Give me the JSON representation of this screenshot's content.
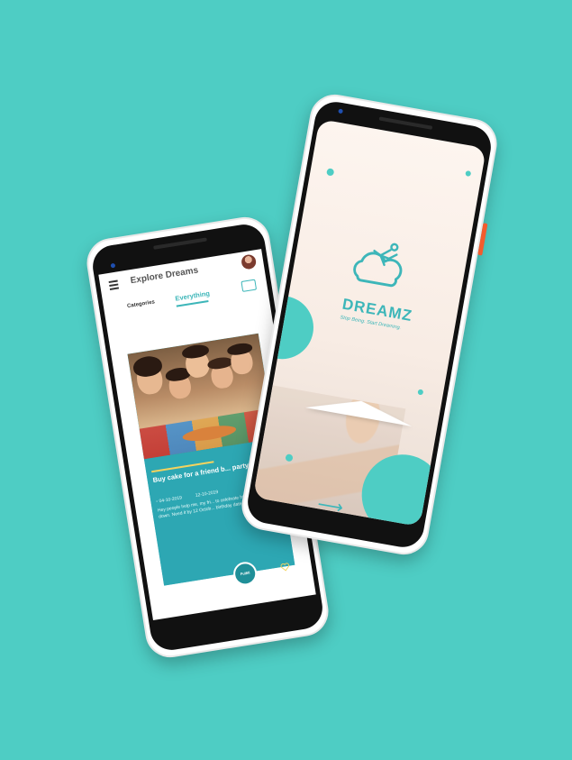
{
  "left_screen": {
    "title": "Explore Dreams",
    "tabs": [
      "Categories",
      "Everything"
    ],
    "card": {
      "title": "Buy cake for a friend b... party",
      "date_start": "04-10-2019",
      "date_end": "12-10-2019",
      "description": "Hey people help me, my fri... to celebrate his birthday, ... him down. Need it by 12 Octob... birthday date.",
      "fulfill_label": "Fulfill"
    }
  },
  "right_screen": {
    "brand": "DREAMZ",
    "tagline": "Stop Being. Start Dreaming."
  },
  "colors": {
    "background": "#4ecdc4",
    "accent": "#3db6b9",
    "card": "#2da7b3",
    "highlight": "#f4d35e",
    "power_button": "#f25c2e"
  },
  "icons": [
    "menu-icon",
    "avatar",
    "truck-icon",
    "calendar-icon",
    "heart-icon",
    "dreamz-logo-icon",
    "arrow-right-icon"
  ]
}
